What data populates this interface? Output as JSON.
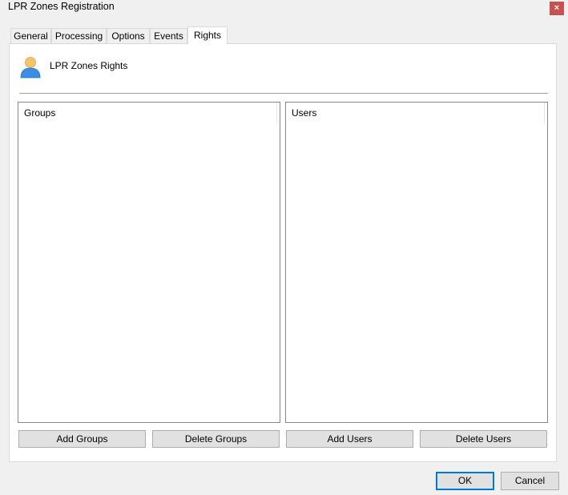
{
  "window": {
    "title": "LPR Zones Registration",
    "close_glyph": "×"
  },
  "tabs": [
    {
      "label": "General"
    },
    {
      "label": "Processing"
    },
    {
      "label": "Options"
    },
    {
      "label": "Events"
    },
    {
      "label": "Rights"
    }
  ],
  "header": {
    "icon": "user-icon",
    "title": "LPR Zones Rights"
  },
  "groups_list": {
    "column": "Groups"
  },
  "users_list": {
    "column": "Users"
  },
  "buttons": {
    "add_groups": "Add Groups",
    "delete_groups": "Delete Groups",
    "add_users": "Add Users",
    "delete_users": "Delete Users",
    "ok": "OK",
    "cancel": "Cancel"
  },
  "colors": {
    "close": "#c75050",
    "default_button_border": "#0078d7"
  }
}
